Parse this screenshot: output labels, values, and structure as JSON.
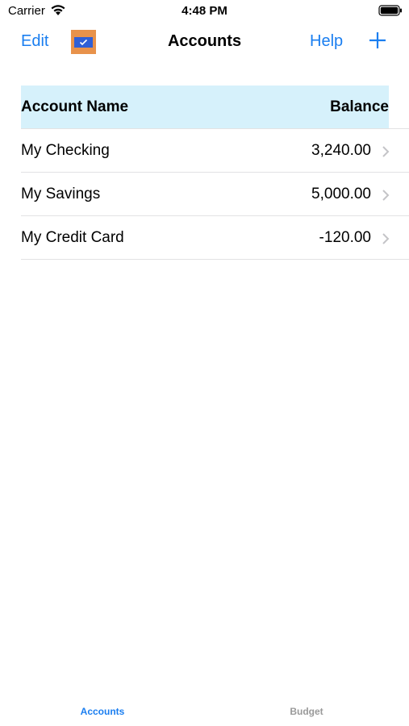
{
  "status_bar": {
    "carrier": "Carrier",
    "time": "4:48 PM",
    "wifi_icon": "wifi-icon",
    "battery_icon": "battery-icon"
  },
  "nav": {
    "edit_label": "Edit",
    "app_icon": "checkbook-icon",
    "title": "Accounts",
    "help_label": "Help",
    "add_icon": "plus-icon"
  },
  "table": {
    "headers": {
      "name": "Account Name",
      "balance": "Balance"
    },
    "rows": [
      {
        "name": "My Checking",
        "balance": "3,240.00"
      },
      {
        "name": "My Savings",
        "balance": "5,000.00"
      },
      {
        "name": "My Credit Card",
        "balance": "-120.00"
      }
    ],
    "chevron_icon": "chevron-right-icon"
  },
  "tab_bar": {
    "tabs": [
      {
        "label": "Accounts",
        "active": true
      },
      {
        "label": "Budget",
        "active": false
      }
    ]
  },
  "colors": {
    "accent": "#1a7ef0",
    "header_bg": "#d6f1fb",
    "app_icon_bg": "#e8924b",
    "inactive_tab": "#9a9a9a"
  }
}
